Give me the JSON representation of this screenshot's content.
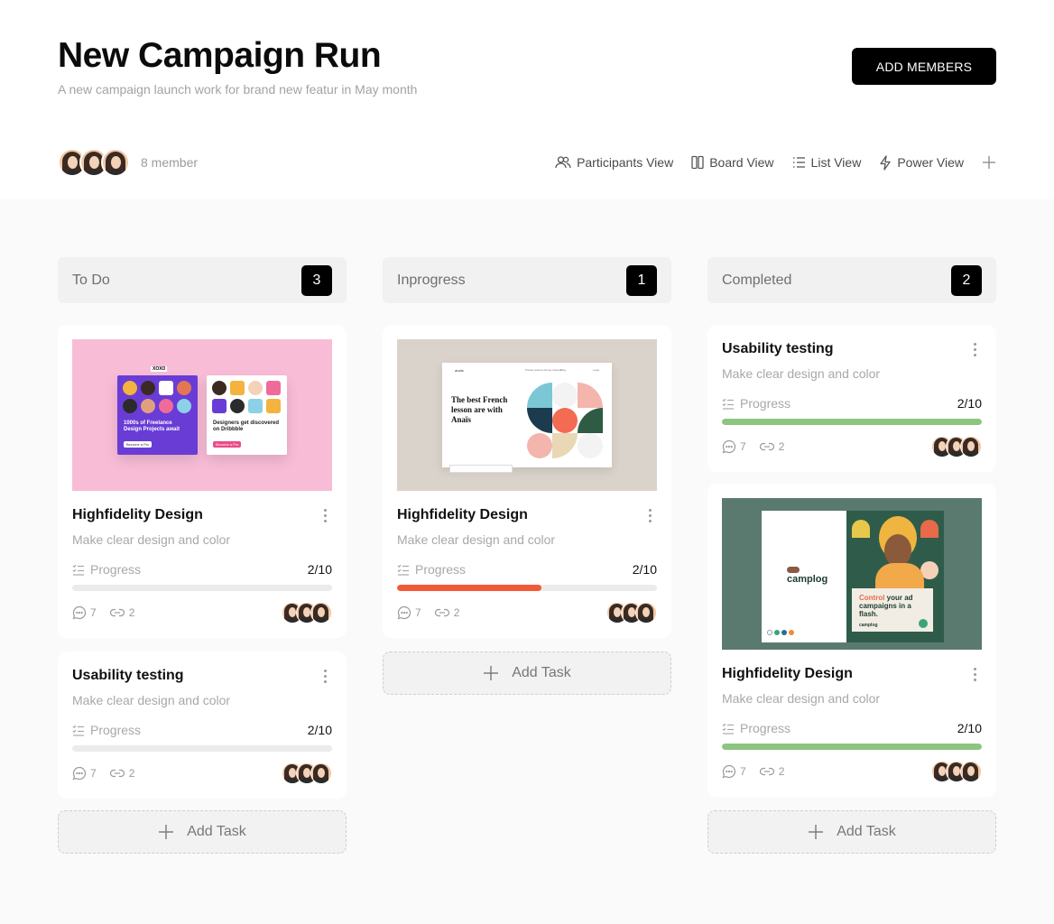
{
  "header": {
    "title": "New Campaign Run",
    "subtitle": "A new campaign launch work for brand new featur in May month",
    "add_members_label": "ADD MEMBERS",
    "member_count": "8 member",
    "views": [
      {
        "label": "Participants View",
        "icon": "participants-icon"
      },
      {
        "label": "Board View",
        "icon": "board-icon"
      },
      {
        "label": "List View",
        "icon": "list-icon"
      },
      {
        "label": "Power View",
        "icon": "lightning-icon"
      }
    ]
  },
  "colors": {
    "accent": "#000000",
    "progress_green": "#8cc57f",
    "progress_orange": "#f25a38",
    "progress_track": "#ebebeb"
  },
  "columns": [
    {
      "title": "To Do",
      "count": "3",
      "cards": [
        {
          "title": "Highfidelity Design",
          "desc": "Make clear design and color",
          "progress_label": "Progress",
          "progress_value": "2/10",
          "progress_fill": 0,
          "comments": "7",
          "links": "2",
          "thumbnail": "dribbble-designers-thumbnail"
        },
        {
          "title": "Usability testing",
          "desc": "Make clear design and color",
          "progress_label": "Progress",
          "progress_value": "2/10",
          "progress_fill": 0,
          "comments": "7",
          "links": "2"
        }
      ],
      "add_task_label": "Add Task"
    },
    {
      "title": "Inprogress",
      "count": "1",
      "cards": [
        {
          "title": "Highfidelity Design",
          "desc": "Make clear design and color",
          "progress_label": "Progress",
          "progress_value": "2/10",
          "progress_fill": 0.5556,
          "comments": "7",
          "links": "2",
          "thumbnail": "french-lesson-thumbnail",
          "thumb_text": {
            "heading": "The best French lesson are with Anaïs",
            "logo": "anaïs",
            "nav": [
              "Private lessons",
              "Group classes",
              "Blog"
            ],
            "login": "Login"
          }
        }
      ],
      "add_task_label": "Add Task"
    },
    {
      "title": "Completed",
      "count": "2",
      "cards": [
        {
          "title": "Usability testing",
          "desc": "Make clear design and color",
          "progress_label": "Progress",
          "progress_value": "2/10",
          "progress_fill": 1,
          "comments": "7",
          "links": "2"
        },
        {
          "title": "Highfidelity Design",
          "desc": "Make clear design and color",
          "progress_label": "Progress",
          "progress_value": "2/10",
          "progress_fill": 1,
          "comments": "7",
          "links": "2",
          "thumbnail": "camplog-thumbnail",
          "thumb_text": {
            "logo": "camplog",
            "headline_accent": "Control",
            "headline": " your ad campaigns in a flash.",
            "brand": "camplog"
          }
        }
      ],
      "add_task_label": "Add Task"
    }
  ],
  "dribbble_thumb": {
    "card1_text": "1000s of Freelance Design Projects await",
    "card1_button": "Become a Pro",
    "card1_badge": "XOXO",
    "card2_text": "Designers get discovered on Dribbble",
    "card2_button": "Become a Pro"
  }
}
